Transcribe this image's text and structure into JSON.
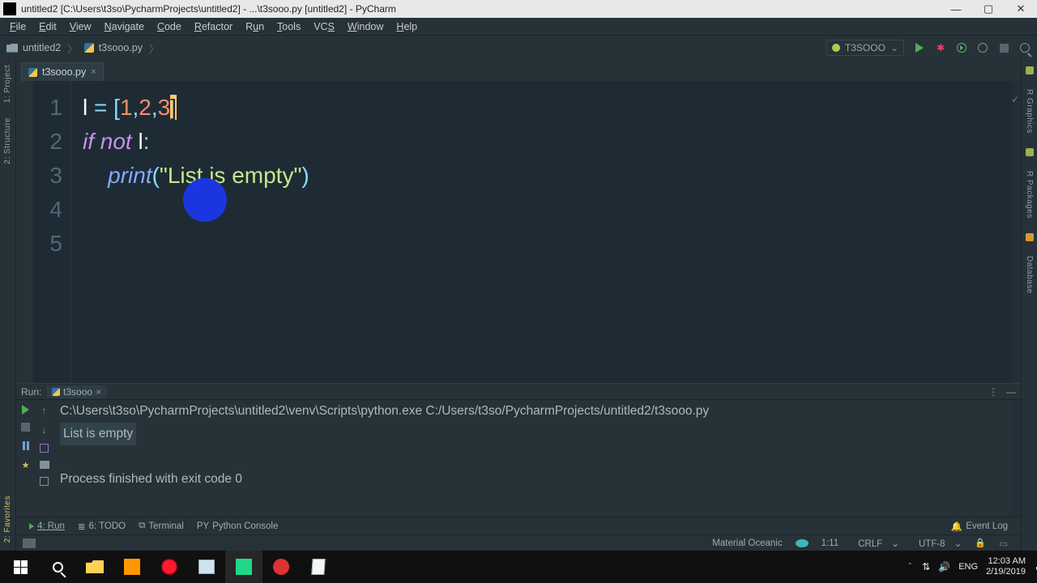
{
  "titlebar": {
    "title": "untitled2 [C:\\Users\\t3so\\PycharmProjects\\untitled2] - ...\\t3sooo.py [untitled2] - PyCharm"
  },
  "menu": [
    "File",
    "Edit",
    "View",
    "Navigate",
    "Code",
    "Refactor",
    "Run",
    "Tools",
    "VCS",
    "Window",
    "Help"
  ],
  "breadcrumbs": {
    "project": "untitled2",
    "file": "t3sooo.py"
  },
  "run_config": {
    "name": "T3SOOO"
  },
  "editor_tab": {
    "name": "t3sooo.py"
  },
  "line_numbers": [
    "1",
    "2",
    "3",
    "4",
    "5"
  ],
  "code": {
    "l1": {
      "var": "l",
      "eq": " = ",
      "ob": "[",
      "n1": "1",
      "c1": ",",
      "n2": "2",
      "c2": ",",
      "n3": "3",
      "cb": "]"
    },
    "l2": {
      "kw_if": "if",
      "kw_not": "not",
      "var": "l",
      "colon": ":"
    },
    "l3": {
      "fn": "print",
      "lp": "(",
      "str": "\"List is empty\"",
      "rp": ")"
    }
  },
  "run_panel": {
    "label": "Run:",
    "tab": "t3sooo",
    "line1": "C:\\Users\\t3so\\PycharmProjects\\untitled2\\venv\\Scripts\\python.exe C:/Users/t3so/PycharmProjects/untitled2/t3sooo.py",
    "line2": "List is empty",
    "line3": "Process finished with exit code 0"
  },
  "bottom": {
    "run": "4: Run",
    "todo": "6: TODO",
    "terminal": "Terminal",
    "pyconsole": "Python Console",
    "eventlog": "Event Log"
  },
  "status": {
    "theme": "Material Oceanic",
    "pos": "1:11",
    "eol": "CRLF",
    "enc": "UTF-8"
  },
  "left_tool_labels": {
    "project": "1: Project",
    "structure": "2: Structure",
    "favorites": "2: Favorites"
  },
  "right_tool_labels": {
    "rgraphics": "R Graphics",
    "rpackages": "R Packages",
    "database": "Database"
  },
  "tray": {
    "net": "↑↓",
    "lang": "ENG",
    "time": "12:03 AM",
    "date": "2/19/2019"
  }
}
